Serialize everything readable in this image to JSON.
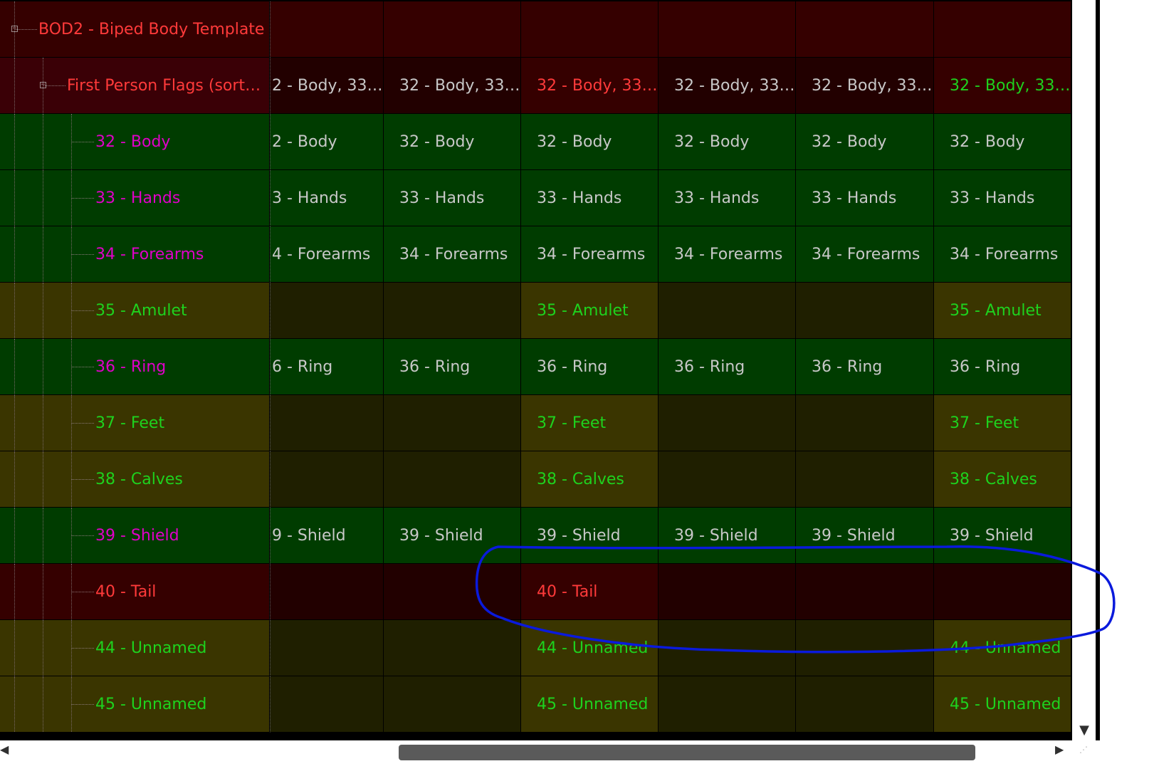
{
  "palette": {
    "bg_red": "#350000",
    "bg_red_dark": "#220000",
    "bg_red_mid": "#3a0006",
    "bg_green": "#003c00",
    "bg_olive": "#3a3500",
    "bg_olive_dark": "#1f1f00",
    "text_red": "#ff3a3a",
    "text_magenta": "#e000c8",
    "text_green": "#1ed21e",
    "text_gray": "#c8c8c8",
    "annotation_blue": "#0a1adc"
  },
  "tree": {
    "root": {
      "label": "BOD2 - Biped Body Template",
      "expanded": true,
      "expander_icon": "minus-box-icon"
    },
    "group": {
      "label": "First Person Flags (sorted)",
      "expanded": true,
      "expander_icon": "minus-box-icon"
    }
  },
  "header_values": [
    "2 - Body, 33 ...",
    "32 - Body, 33 ...",
    "32 - Body, 33 ...",
    "32 - Body, 33 ...",
    "32 - Body, 33 ...",
    "32 - Body, 33 ..."
  ],
  "header_colors": [
    "gray",
    "gray",
    "red",
    "gray",
    "gray",
    "green"
  ],
  "rows": [
    {
      "label": "32 - Body",
      "kind": "green",
      "label_color": "magenta",
      "values": [
        "2 - Body",
        "32 - Body",
        "32 - Body",
        "32 - Body",
        "32 - Body",
        "32 - Body"
      ]
    },
    {
      "label": "33 - Hands",
      "kind": "green",
      "label_color": "magenta",
      "values": [
        "3 - Hands",
        "33 - Hands",
        "33 - Hands",
        "33 - Hands",
        "33 - Hands",
        "33 - Hands"
      ]
    },
    {
      "label": "34 - Forearms",
      "kind": "green",
      "label_color": "magenta",
      "values": [
        "4 - Forearms",
        "34 - Forearms",
        "34 - Forearms",
        "34 - Forearms",
        "34 - Forearms",
        "34 - Forearms"
      ]
    },
    {
      "label": "35 - Amulet",
      "kind": "olive",
      "label_color": "green",
      "values": [
        "",
        "",
        "35 - Amulet",
        "",
        "",
        "35 - Amulet"
      ]
    },
    {
      "label": "36 - Ring",
      "kind": "green",
      "label_color": "magenta",
      "values": [
        "6 - Ring",
        "36 - Ring",
        "36 - Ring",
        "36 - Ring",
        "36 - Ring",
        "36 - Ring"
      ]
    },
    {
      "label": "37 - Feet",
      "kind": "olive",
      "label_color": "green",
      "values": [
        "",
        "",
        "37 - Feet",
        "",
        "",
        "37 - Feet"
      ]
    },
    {
      "label": "38 - Calves",
      "kind": "olive",
      "label_color": "green",
      "values": [
        "",
        "",
        "38 - Calves",
        "",
        "",
        "38 - Calves"
      ]
    },
    {
      "label": "39 - Shield",
      "kind": "green",
      "label_color": "magenta",
      "values": [
        "9 - Shield",
        "39 - Shield",
        "39 - Shield",
        "39 - Shield",
        "39 - Shield",
        "39 - Shield"
      ]
    },
    {
      "label": "40 - Tail",
      "kind": "red",
      "label_color": "red",
      "values": [
        "",
        "",
        "40 - Tail",
        "",
        "",
        ""
      ]
    },
    {
      "label": "44 - Unnamed",
      "kind": "olive",
      "label_color": "green",
      "values": [
        "",
        "",
        "44 - Unnamed",
        "",
        "",
        "44 - Unnamed"
      ]
    },
    {
      "label": "45 - Unnamed",
      "kind": "olive",
      "label_color": "green",
      "values": [
        "",
        "",
        "45 - Unnamed",
        "",
        "",
        "45 - Unnamed"
      ]
    }
  ],
  "scrollbars": {
    "down_arrow_icon": "triangle-down-icon",
    "left_arrow_icon": "triangle-left-icon",
    "right_arrow_icon": "triangle-right-icon",
    "horizontal_thumb_position": 0.45
  }
}
